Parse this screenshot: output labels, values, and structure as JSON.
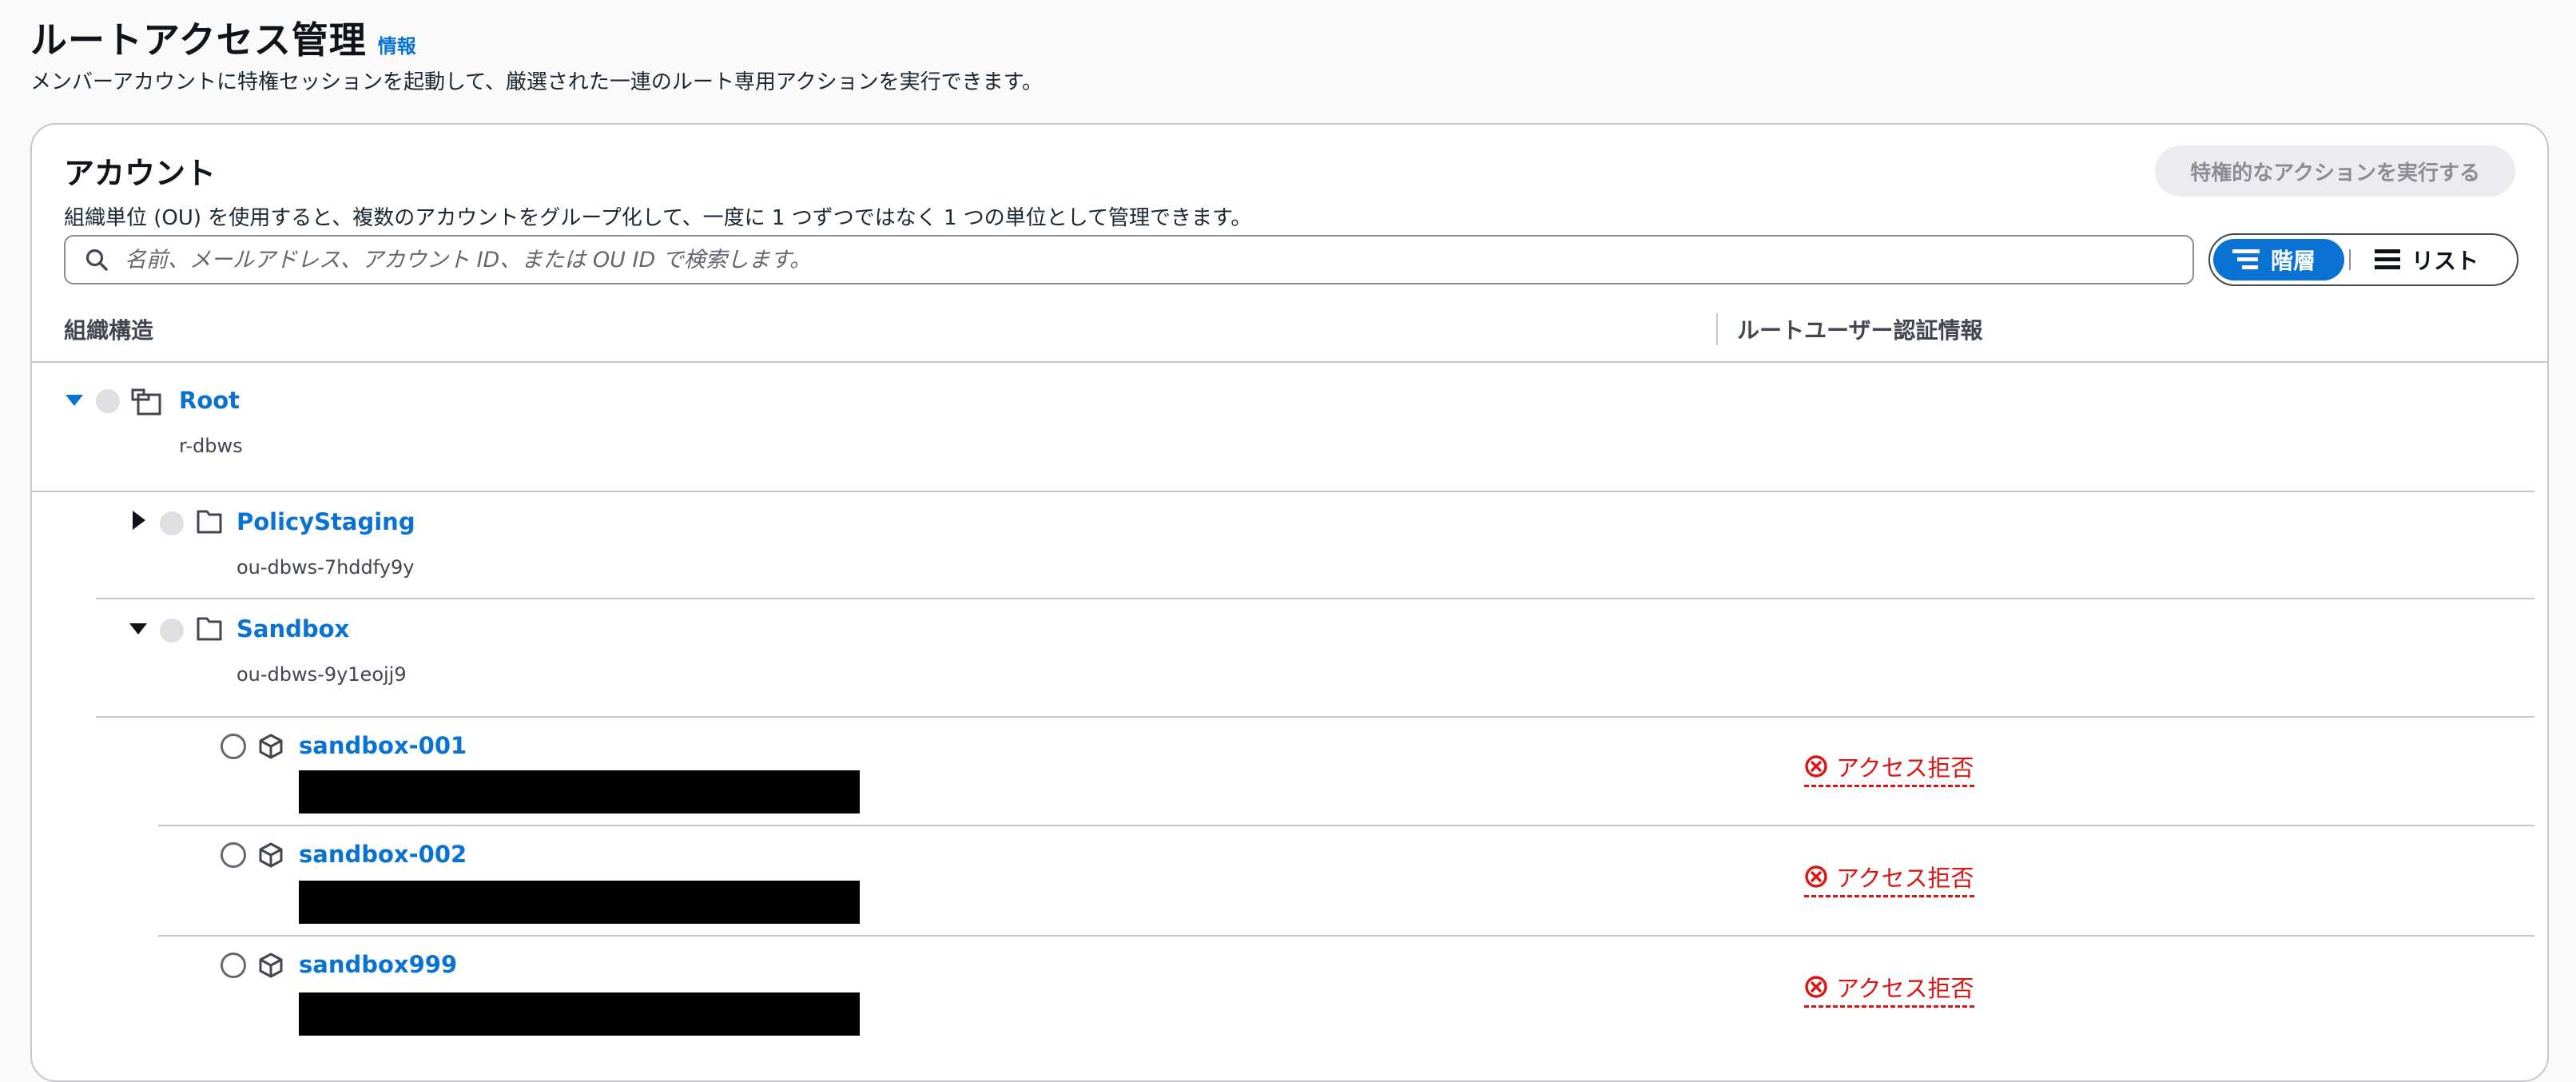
{
  "page": {
    "title": "ルートアクセス管理",
    "info_link": "情報",
    "description": "メンバーアカウントに特権セッションを起動して、厳選された一連のルート専用アクションを実行できます。"
  },
  "card": {
    "title": "アカウント",
    "description": "組織単位 (OU) を使用すると、複数のアカウントをグループ化して、一度に 1 つずつではなく 1 つの単位として管理できます。",
    "privileged_action_button": "特権的なアクションを実行する",
    "search_placeholder": "名前、メールアドレス、アカウント ID、または OU ID で検索します。",
    "view_toggle": {
      "hierarchy": "階層",
      "list": "リスト"
    },
    "columns": {
      "structure": "組織構造",
      "root_credentials": "ルートユーザー認証情報"
    }
  },
  "tree": {
    "root": {
      "name": "Root",
      "id": "r-dbws"
    },
    "ou_policy_staging": {
      "name": "PolicyStaging",
      "id": "ou-dbws-7hddfy9y"
    },
    "ou_sandbox": {
      "name": "Sandbox",
      "id": "ou-dbws-9y1eojj9"
    },
    "accounts": [
      {
        "name": "sandbox-001",
        "status": "アクセス拒否"
      },
      {
        "name": "sandbox-002",
        "status": "アクセス拒否"
      },
      {
        "name": "sandbox999",
        "status": "アクセス拒否"
      }
    ]
  },
  "colors": {
    "link": "#0972d3",
    "error": "#d91515",
    "border": "#c6c6cd"
  }
}
